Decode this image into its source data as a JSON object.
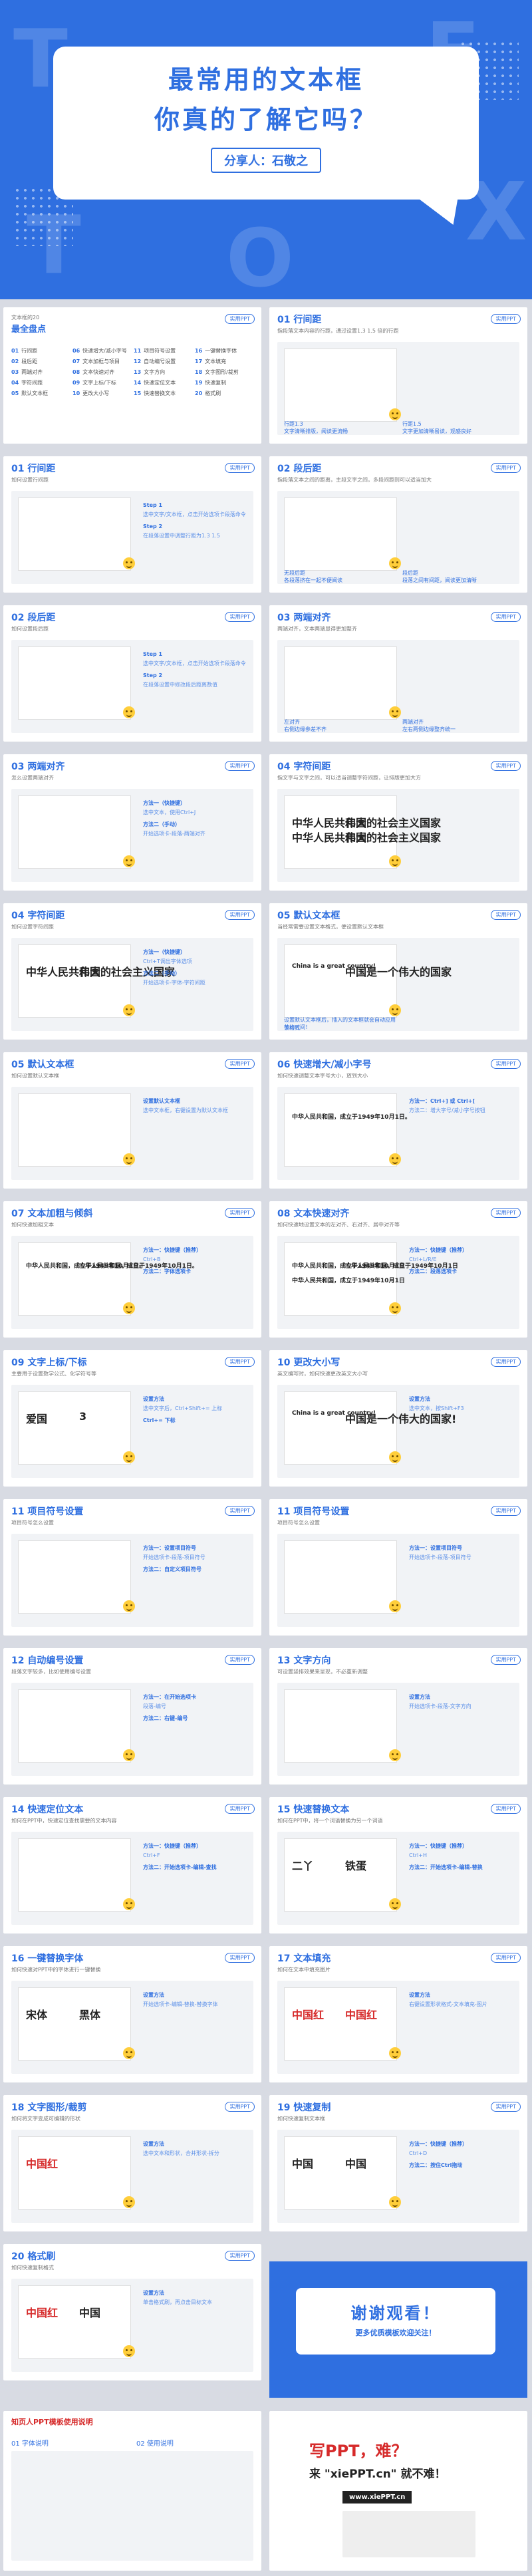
{
  "hero": {
    "title_line1": "最常用的文本框",
    "title_line2": "你真的了解它吗？",
    "sharer": "分享人：石敬之",
    "deco_letters": [
      "T",
      "E",
      "X",
      "T",
      "O"
    ]
  },
  "common_tag": "实用PPT",
  "toc": {
    "title": "最全盘点",
    "subtitle": "文本框的20",
    "items": [
      {
        "no": "01",
        "label": "行间距"
      },
      {
        "no": "02",
        "label": "段后距"
      },
      {
        "no": "03",
        "label": "两端对齐"
      },
      {
        "no": "04",
        "label": "字符间距"
      },
      {
        "no": "05",
        "label": "默认文本框"
      },
      {
        "no": "06",
        "label": "快速增大/减小字号"
      },
      {
        "no": "07",
        "label": "文本加框与项目"
      },
      {
        "no": "08",
        "label": "文本快速对齐"
      },
      {
        "no": "09",
        "label": "文字上标/下标"
      },
      {
        "no": "10",
        "label": "更改大小写"
      },
      {
        "no": "11",
        "label": "项目符号设置"
      },
      {
        "no": "12",
        "label": "自动编号设置"
      },
      {
        "no": "13",
        "label": "文字方向"
      },
      {
        "no": "14",
        "label": "快速定位文本"
      },
      {
        "no": "15",
        "label": "快速替换文本"
      },
      {
        "no": "16",
        "label": "一键替换字体"
      },
      {
        "no": "17",
        "label": "文本填充"
      },
      {
        "no": "18",
        "label": "文字图形/裁剪"
      },
      {
        "no": "19",
        "label": "快速复制"
      },
      {
        "no": "20",
        "label": "格式刷"
      }
    ]
  },
  "slides": [
    {
      "no": "01 行间距",
      "sub": "指段落文本内容的行距，通过设置1.3 1.5 倍的行距",
      "notes": [
        "行距1.3",
        "文字清晰排版，阅读更流畅",
        "行距1.5",
        "文字更加清晰易读，观感良好"
      ]
    },
    {
      "no": "01 行间距",
      "sub": "如何设置行间距",
      "steps": [
        "Step 1",
        "选中文字/文本框，点击开始选项卡段落命令",
        "Step 2",
        "在段落设置中调整行距为1.3 1.5"
      ]
    },
    {
      "no": "02 段后距",
      "sub": "指段落文本之间的距离，主段文字之间，多段间距则可以适当加大",
      "notes": [
        "无段后距",
        "各段落挤在一起不便阅读",
        "段后距",
        "段落之间有间距，阅读更加清晰"
      ]
    },
    {
      "no": "02 段后距",
      "sub": "如何设置段后距",
      "steps": [
        "Step 1",
        "选中文字/文本框，点击开始选项卡段落命令",
        "Step 2",
        "在段落设置中修改段后距离数值"
      ]
    },
    {
      "no": "03 两端对齐",
      "sub": "两端对齐，文本两端显得更加整齐",
      "notes": [
        "左对齐",
        "右侧边缘参差不齐",
        "两端对齐",
        "左右两侧边缘整齐统一"
      ]
    },
    {
      "no": "03 两端对齐",
      "sub": "怎么设置两端对齐",
      "steps": [
        "方法一（快捷键）",
        "选中文本，使用Ctrl+J",
        "方法二（手动）",
        "开始选项卡-段落-两端对齐"
      ]
    },
    {
      "no": "04 字符间距",
      "sub": "指文字与文字之间，可以适当调整字符间距，让排版更加大方",
      "texts": [
        "中华人民共和国",
        "伟大的社会主义国家",
        "中华人民共和国",
        "伟大的社会主义国家"
      ]
    },
    {
      "no": "04 字符间距",
      "sub": "如何设置字符间距",
      "texts": [
        "中华人民共和国",
        "伟大的社会主义国家"
      ],
      "steps": [
        "方法一（快捷键）",
        "Ctrl+T调出字体选项",
        "方法二（手动）",
        "开始选项卡-字体-字符间距"
      ]
    },
    {
      "no": "05 默认文本框",
      "sub": "当经常需要设置文本格式，便设置默认文本框",
      "texts": [
        "China is a great country!",
        "中国是一个伟大的国家"
      ],
      "notes": [
        "设置默认文本框后，插入的文本框就会自动应用该格式",
        "节约时间！"
      ]
    },
    {
      "no": "05 默认文本框",
      "sub": "如何设置默认文本框",
      "steps": [
        "设置默认文本框",
        "选中文本框，右键设置为默认文本框"
      ]
    },
    {
      "no": "06 快速增大/减小字号",
      "sub": "如何快速调整文本字号大小，放到大小",
      "texts": [
        "中华人民共和国，成立于1949年10月1日。"
      ],
      "steps": [
        "方法一：Ctrl+] 或 Ctrl+[",
        "方法二：增大字号/减小字号按钮"
      ]
    },
    {
      "no": "07 文本加粗与倾斜",
      "sub": "如何快速加粗文本",
      "texts": [
        "中华人民共和国，成立于1949年10月1日。",
        "中华人民共和国，成立于1949年10月1日。"
      ],
      "steps": [
        "方法一：快捷键（推荐）",
        "Ctrl+B",
        "方法二：字体选项卡"
      ]
    },
    {
      "no": "08 文本快速对齐",
      "sub": "如何快速地设置文本的左对齐、右对齐、居中对齐等",
      "texts": [
        "中华人民共和国，成立于1949年10月1日",
        "中华人民共和国，成立于1949年10月1日",
        "中华人民共和国，成立于1949年10月1日"
      ],
      "steps": [
        "方法一：快捷键（推荐）",
        "Ctrl+L/R/E",
        "方法二：段落选项卡"
      ]
    },
    {
      "no": "09 文字上标/下标",
      "sub": "主要用于设置数学公式、化学符号等",
      "texts": [
        "爱国",
        "3"
      ],
      "steps": [
        "设置方法",
        "选中文字后，Ctrl+Shift+= 上标",
        "Ctrl+= 下标"
      ]
    },
    {
      "no": "10 更改大小写",
      "sub": "英文编写时，如何快速更改英文大小写",
      "texts": [
        "China is a great country!",
        "中国是一个伟大的国家!"
      ],
      "steps": [
        "设置方法",
        "选中文本，按Shift+F3"
      ]
    },
    {
      "no": "11 项目符号设置",
      "sub": "项目符号怎么设置",
      "steps": [
        "方法一：设置项目符号",
        "开始选项卡-段落-项目符号",
        "方法二：自定义项目符号"
      ]
    },
    {
      "no": "11 项目符号设置",
      "sub": "项目符号怎么设置",
      "steps": [
        "方法一：设置项目符号",
        "开始选项卡-段落-项目符号"
      ]
    },
    {
      "no": "12 自动编号设置",
      "sub": "段落文字较多，比如使用编号设置",
      "steps": [
        "方法一：在开始选项卡",
        "段落-编号",
        "方法二：右键-编号"
      ]
    },
    {
      "no": "13 文字方向",
      "sub": "可设置竖排效果来呈现，不必重新调整",
      "steps": [
        "设置方法",
        "开始选项卡-段落-文字方向"
      ]
    },
    {
      "no": "14 快速定位文本",
      "sub": "如何在PPT中，快速定位查找需要的文本内容",
      "steps": [
        "方法一：快捷键（推荐）",
        "Ctrl+F",
        "方法二：开始选项卡-编辑-查找"
      ]
    },
    {
      "no": "15 快速替换文本",
      "sub": "如何在PPT中，将一个词语替换为另一个词语",
      "texts": [
        "二丫",
        "铁蛋"
      ],
      "steps": [
        "方法一：快捷键（推荐）",
        "Ctrl+H",
        "方法二：开始选项卡-编辑-替换"
      ]
    },
    {
      "no": "16 一键替换字体",
      "sub": "如何快速对PPT中的字体进行一键替换",
      "texts": [
        "宋体",
        "黑体"
      ],
      "steps": [
        "设置方法",
        "开始选项卡-编辑-替换-替换字体"
      ]
    },
    {
      "no": "17 文本填充",
      "sub": "如何在文本中填充图片",
      "texts": [
        "中国红",
        "中国红"
      ],
      "steps": [
        "设置方法",
        "右键设置形状格式-文本填充-图片"
      ]
    },
    {
      "no": "18 文字图形/裁剪",
      "sub": "如何将文字变成可编辑的形状",
      "texts": [
        "中国红"
      ],
      "steps": [
        "设置方法",
        "选中文本和形状，合并形状-拆分"
      ]
    },
    {
      "no": "19 快速复制",
      "sub": "如何快速复制文本框",
      "texts": [
        "中国",
        "中国"
      ],
      "steps": [
        "方法一：快捷键（推荐）",
        "Ctrl+D",
        "方法二：按住Ctrl拖动"
      ]
    },
    {
      "no": "20 格式刷",
      "sub": "如何快速复制格式",
      "texts": [
        "中国红",
        "中国"
      ],
      "steps": [
        "设置方法",
        "单击格式刷，再点击目标文本"
      ]
    }
  ],
  "thanks": {
    "line1": "谢谢观看！",
    "line2": "更多优质模板欢迎关注！"
  },
  "footer": {
    "left_title": "知页人PPT模板使用说明",
    "left_sub": "01 字体说明",
    "left_sub2": "02 使用说明",
    "right_line1": "写PPT，难？",
    "right_line2": "来 \"xiePPT.cn\" 就不难！",
    "right_line3": "www.xiePPT.cn"
  }
}
